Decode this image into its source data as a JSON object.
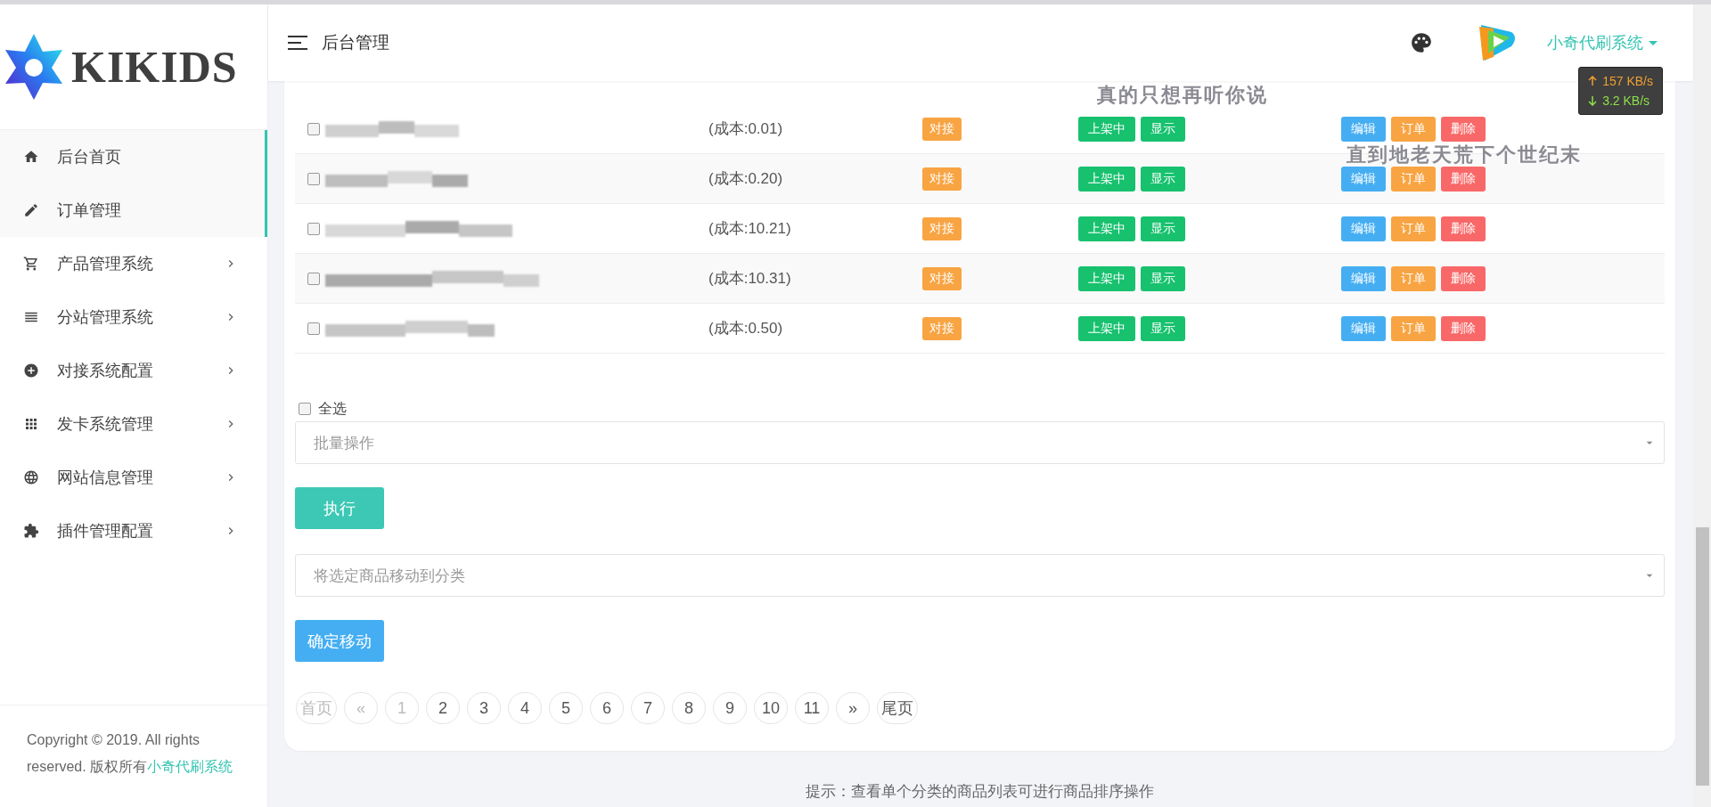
{
  "brand": {
    "name": "KIKIDS"
  },
  "sidebar": {
    "items": [
      {
        "label": "后台首页",
        "selected": true,
        "has_submenu": false
      },
      {
        "label": "订单管理",
        "selected": true,
        "has_submenu": false
      },
      {
        "label": "产品管理系统",
        "selected": false,
        "has_submenu": true
      },
      {
        "label": "分站管理系统",
        "selected": false,
        "has_submenu": true
      },
      {
        "label": "对接系统配置",
        "selected": false,
        "has_submenu": true
      },
      {
        "label": "发卡系统管理",
        "selected": false,
        "has_submenu": true
      },
      {
        "label": "网站信息管理",
        "selected": false,
        "has_submenu": true
      },
      {
        "label": "插件管理配置",
        "selected": false,
        "has_submenu": true
      }
    ],
    "copyright": "Copyright © 2019. All rights reserved. 版权所有",
    "copyright_link": "小奇代刷系统"
  },
  "header": {
    "title": "后台管理",
    "user": "小奇代刷系统"
  },
  "speed": {
    "up": "157 KB/s",
    "down": "3.2 KB/s"
  },
  "lyrics": [
    "真的只想再听你说",
    "直到地老天荒下个世纪末"
  ],
  "products": {
    "rows": [
      {
        "checked": false,
        "cost": "(成本:0.01)",
        "source": "对接",
        "status": "上架中",
        "visibility": "显示",
        "actions": [
          "编辑",
          "订单",
          "删除"
        ]
      },
      {
        "checked": false,
        "cost": "(成本:0.20)",
        "source": "对接",
        "status": "上架中",
        "visibility": "显示",
        "actions": [
          "编辑",
          "订单",
          "删除"
        ]
      },
      {
        "checked": false,
        "cost": "(成本:10.21)",
        "source": "对接",
        "status": "上架中",
        "visibility": "显示",
        "actions": [
          "编辑",
          "订单",
          "删除"
        ]
      },
      {
        "checked": false,
        "cost": "(成本:10.31)",
        "source": "对接",
        "status": "上架中",
        "visibility": "显示",
        "actions": [
          "编辑",
          "订单",
          "删除"
        ]
      },
      {
        "checked": false,
        "cost": "(成本:0.50)",
        "source": "对接",
        "status": "上架中",
        "visibility": "显示",
        "actions": [
          "编辑",
          "订单",
          "删除"
        ]
      }
    ]
  },
  "select_all": {
    "label": "全选",
    "checked": false
  },
  "batch_select": {
    "placeholder": "批量操作"
  },
  "execute_button": "执行",
  "move_select": {
    "placeholder": "将选定商品移动到分类"
  },
  "move_button": "确定移动",
  "pagination": [
    {
      "label": "首页",
      "disabled": true
    },
    {
      "label": "«",
      "disabled": true
    },
    {
      "label": "1",
      "disabled": true
    },
    {
      "label": "2",
      "disabled": false
    },
    {
      "label": "3",
      "disabled": false
    },
    {
      "label": "4",
      "disabled": false
    },
    {
      "label": "5",
      "disabled": false
    },
    {
      "label": "6",
      "disabled": false
    },
    {
      "label": "7",
      "disabled": false
    },
    {
      "label": "8",
      "disabled": false
    },
    {
      "label": "9",
      "disabled": false
    },
    {
      "label": "10",
      "disabled": false
    },
    {
      "label": "11",
      "disabled": false
    },
    {
      "label": "»",
      "disabled": false
    },
    {
      "label": "尾页",
      "disabled": false
    }
  ],
  "hint": "提示：查看单个分类的商品列表可进行商品排序操作"
}
